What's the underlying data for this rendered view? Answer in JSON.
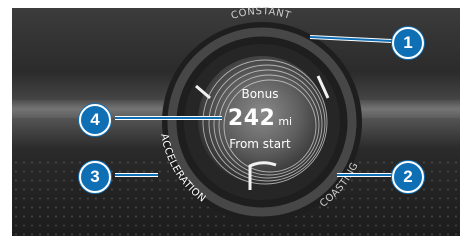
{
  "gauge": {
    "top_label": "CONSTANT",
    "left_label": "ACCELERATION",
    "right_label": "COASTING",
    "readout_title": "Bonus",
    "readout_value": "242",
    "readout_unit": "mi",
    "readout_subtitle": "From start"
  },
  "callouts": [
    "1",
    "2",
    "3",
    "4"
  ],
  "colors": {
    "callout": "#0f6fb5",
    "leader_line": "#0f6fb5",
    "text": "#ffffff"
  }
}
